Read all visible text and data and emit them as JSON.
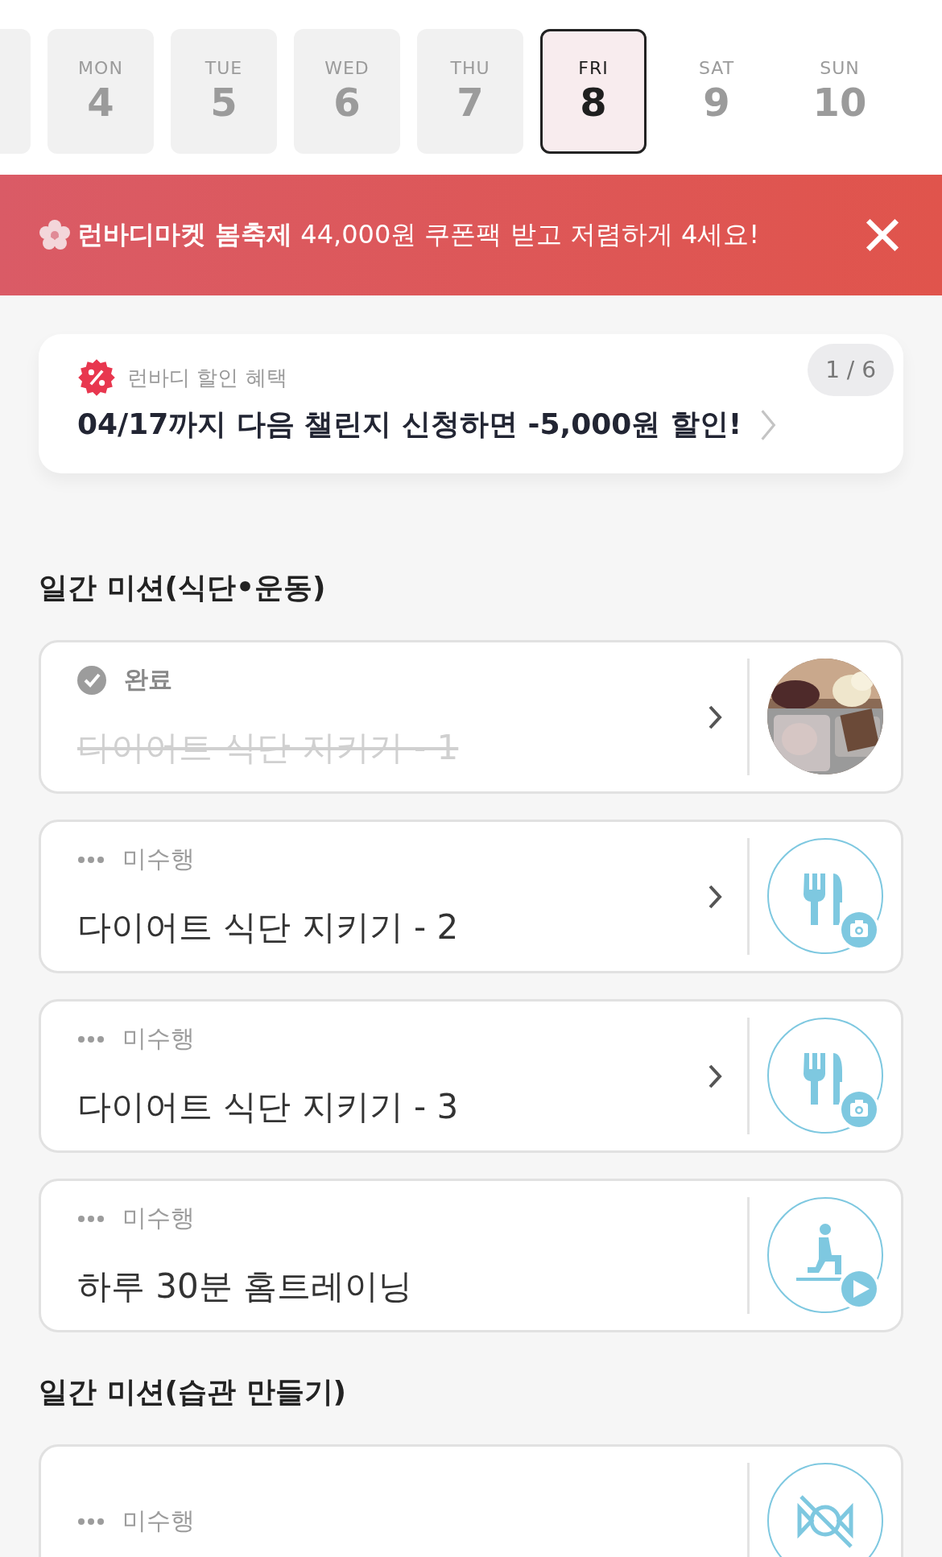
{
  "days": [
    {
      "weekday": "MON",
      "date": "4",
      "selected": false,
      "past": true
    },
    {
      "weekday": "TUE",
      "date": "5",
      "selected": false,
      "past": true
    },
    {
      "weekday": "WED",
      "date": "6",
      "selected": false,
      "past": true
    },
    {
      "weekday": "THU",
      "date": "7",
      "selected": false,
      "past": true
    },
    {
      "weekday": "FRI",
      "date": "8",
      "selected": true,
      "past": false
    },
    {
      "weekday": "SAT",
      "date": "9",
      "selected": false,
      "past": false
    },
    {
      "weekday": "SUN",
      "date": "10",
      "selected": false,
      "past": false
    }
  ],
  "banner": {
    "text": "**런바디마켓 봄축제** 44,000원 쿠폰팩 받고 저렴하게 4세요!"
  },
  "promo": {
    "label": "런바디 할인 혜택",
    "counter": "1 / 6",
    "title": "04/17까지 다음 챌린지 신청하면 -5,000원 할인!"
  },
  "sections": [
    {
      "heading": "일간 미션(식단•운동)",
      "missions": [
        {
          "status": {
            "kind": "done",
            "label": "완료"
          },
          "title": "다이어트 식단 지키기 - 1",
          "arrow": true
        },
        {
          "status": {
            "kind": "pending",
            "label": "미수행"
          },
          "title": "다이어트 식단 지키기 - 2",
          "arrow": true,
          "kind": "meal"
        },
        {
          "status": {
            "kind": "pending",
            "label": "미수행"
          },
          "title": "다이어트 식단 지키기 - 3",
          "arrow": true,
          "kind": "meal"
        },
        {
          "status": {
            "kind": "pending",
            "label": "미수행"
          },
          "title": "하루 30분 홈트레이닝",
          "arrow": false,
          "kind": "exercise"
        }
      ]
    },
    {
      "heading": "일간 미션(습관 만들기)",
      "missions": [
        {
          "status": {
            "kind": "pending",
            "label": "미수행"
          },
          "arrow": false,
          "kind": "nosnack"
        }
      ]
    }
  ]
}
